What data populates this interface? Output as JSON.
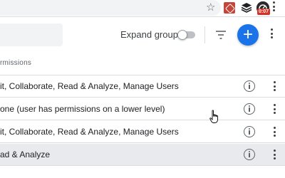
{
  "browser": {
    "star_icon": "star-icon",
    "extensions": [
      "pdf-extension-icon",
      "layers-extension-icon",
      "gauge-extension-icon"
    ],
    "badge_text": "0:07"
  },
  "toolbar": {
    "expand_groups_label": "Expand groups",
    "expand_groups_on": false,
    "add_label": "+"
  },
  "table": {
    "column_header": "rmissions",
    "rows": [
      {
        "text": "it, Collaborate, Read & Analyze, Manage Users",
        "selected": false
      },
      {
        "text": "one (user has permissions on a lower level)",
        "selected": false
      },
      {
        "text": "it, Collaborate, Read & Analyze, Manage Users",
        "selected": false
      },
      {
        "text": "ad & Analyze",
        "selected": true
      }
    ]
  },
  "colors": {
    "accent": "#1a73e8",
    "selected_row": "#e8eaed",
    "badge": "#d93025"
  }
}
